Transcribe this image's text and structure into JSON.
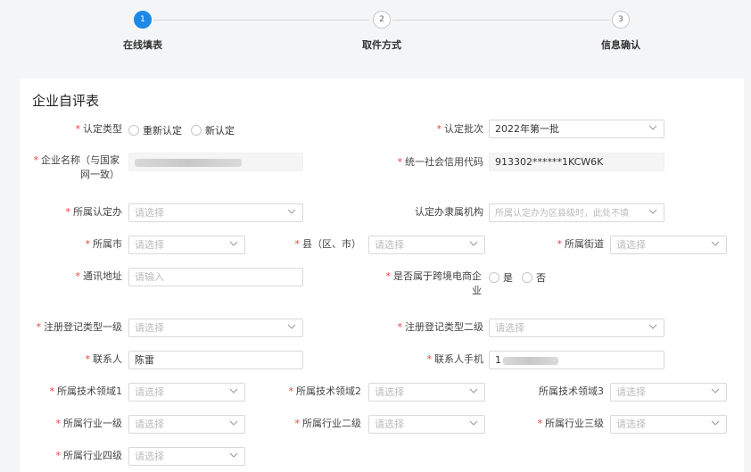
{
  "steps": [
    {
      "num": "1",
      "label": "在线填表"
    },
    {
      "num": "2",
      "label": "取件方式"
    },
    {
      "num": "3",
      "label": "信息确认"
    }
  ],
  "form": {
    "title": "企业自评表",
    "required_mark": "*",
    "cert_type": {
      "label": "认定类型",
      "options": [
        "重新认定",
        "新认定"
      ]
    },
    "cert_batch": {
      "label": "认定批次",
      "value": "2022年第一批"
    },
    "company_name": {
      "label": "企业名称（与国家网一致）",
      "value": ""
    },
    "credit_code": {
      "label": "统一社会信用代码",
      "value": "913302******1KCW6K"
    },
    "cert_office": {
      "label": "所属认定办",
      "placeholder": "请选择"
    },
    "office_org": {
      "label": "认定办隶属机构",
      "placeholder": "所属认定办为区县级时，此处不填"
    },
    "city": {
      "label": "所属市",
      "placeholder": "请选择"
    },
    "county": {
      "label": "县（区、市）",
      "placeholder": "请选择"
    },
    "street": {
      "label": "所属街道",
      "placeholder": "请选择"
    },
    "address": {
      "label": "通讯地址",
      "placeholder": "请输入"
    },
    "cross_border": {
      "label": "是否属于跨境电商企业",
      "options": [
        "是",
        "否"
      ]
    },
    "reg_type1": {
      "label": "注册登记类型一级",
      "placeholder": "请选择"
    },
    "reg_type2": {
      "label": "注册登记类型二级",
      "placeholder": "请选择"
    },
    "contact": {
      "label": "联系人",
      "value": "陈雷"
    },
    "contact_phone": {
      "label": "联系人手机",
      "value": "1"
    },
    "tech1": {
      "label": "所属技术领域1",
      "placeholder": "请选择"
    },
    "tech2": {
      "label": "所属技术领域2",
      "placeholder": "请选择"
    },
    "tech3": {
      "label": "所属技术领域3",
      "placeholder": "请选择"
    },
    "ind1": {
      "label": "所属行业一级",
      "placeholder": "请选择"
    },
    "ind2": {
      "label": "所属行业二级",
      "placeholder": "请选择"
    },
    "ind3": {
      "label": "所属行业三级",
      "placeholder": "请选择"
    },
    "ind4": {
      "label": "所属行业四级",
      "placeholder": "请选择"
    }
  },
  "colors": {
    "accent": "#1e88e5",
    "required": "#f03c3c"
  }
}
